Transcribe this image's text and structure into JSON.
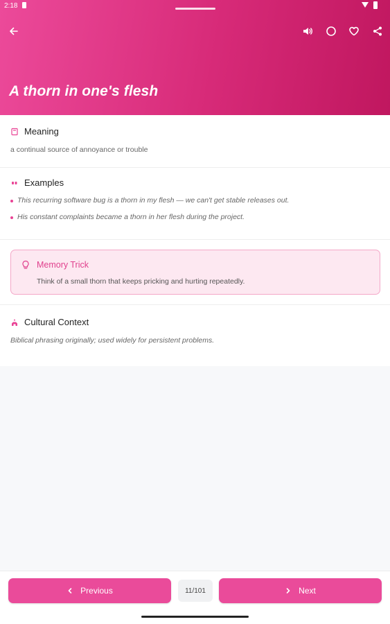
{
  "status_bar": {
    "time": "2:18"
  },
  "header": {
    "title": "A thorn in one's flesh",
    "icons": [
      "back-arrow-icon",
      "speaker-icon",
      "circle-icon",
      "heart-icon",
      "share-icon"
    ],
    "gradient_colors": [
      "#ec4a9a",
      "#c0175f"
    ]
  },
  "meaning": {
    "heading": "Meaning",
    "text": "a continual source of annoyance or trouble"
  },
  "examples": {
    "heading": "Examples",
    "items": [
      "This recurring software bug is a thorn in my flesh — we can't get stable releases out.",
      "His constant complaints became a thorn in her flesh during the project."
    ]
  },
  "memory_trick": {
    "heading": "Memory Trick",
    "text": "Think of a small thorn that keeps pricking and hurting repeatedly."
  },
  "cultural_context": {
    "heading": "Cultural Context",
    "text": "Biblical phrasing originally; used widely for persistent problems."
  },
  "navigation": {
    "previous_label": "Previous",
    "next_label": "Next",
    "counter": "11/101"
  },
  "colors": {
    "accent": "#ea4b9a",
    "memory_background": "#fde8f1",
    "memory_border": "#f4a7c8"
  }
}
